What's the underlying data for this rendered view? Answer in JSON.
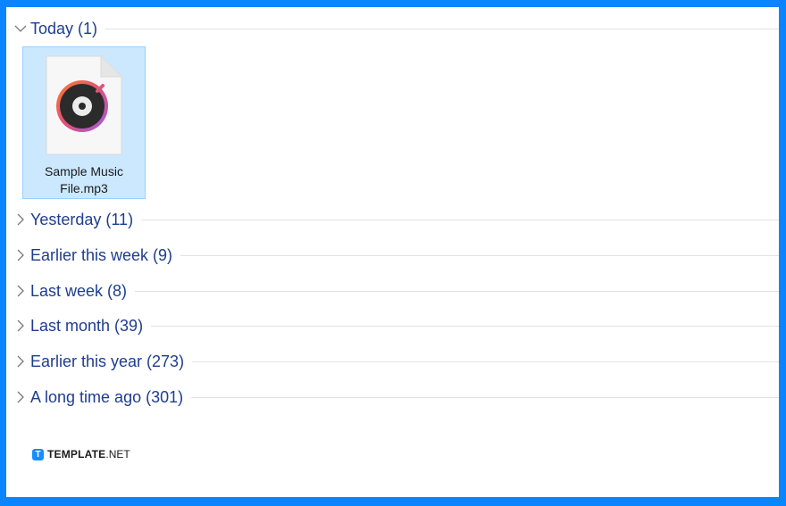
{
  "groups": [
    {
      "label": "Today (1)",
      "expanded": true
    },
    {
      "label": "Yesterday (11)",
      "expanded": false
    },
    {
      "label": "Earlier this week (9)",
      "expanded": false
    },
    {
      "label": "Last week (8)",
      "expanded": false
    },
    {
      "label": "Last month (39)",
      "expanded": false
    },
    {
      "label": "Earlier this year (273)",
      "expanded": false
    },
    {
      "label": "A long time ago (301)",
      "expanded": false
    }
  ],
  "file": {
    "name_line1": "Sample Music",
    "name_line2": "File.mp3",
    "icon": "music-file-icon",
    "selected": true
  },
  "branding": {
    "logo_letter": "T",
    "name_bold": "TEMPLATE",
    "name_light": ".NET"
  },
  "colors": {
    "frame": "#0a84ff",
    "group_label": "#1e3d8f",
    "selection_bg": "#cce8ff",
    "selection_border": "#99d1ff"
  }
}
